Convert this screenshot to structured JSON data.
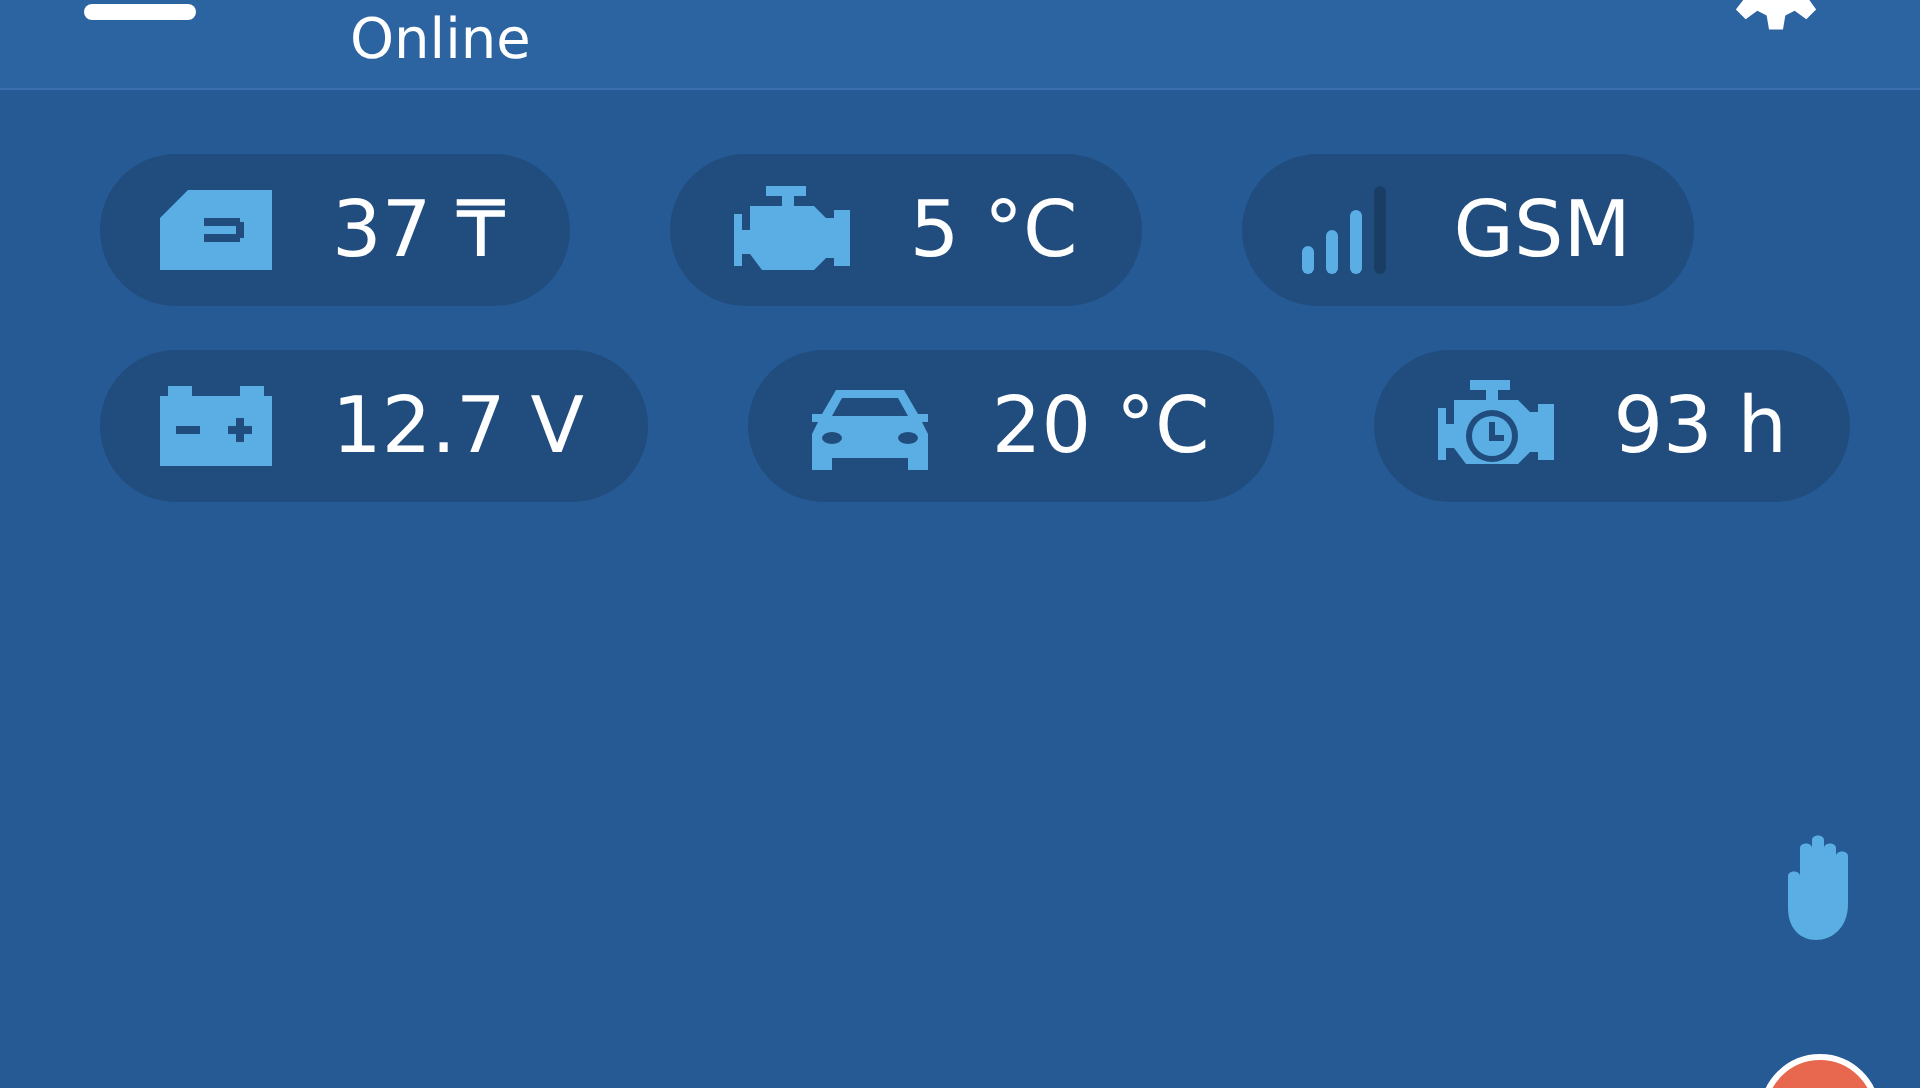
{
  "header": {
    "status": "Online"
  },
  "rows": [
    [
      {
        "kind": "sim",
        "value": "37 ₸"
      },
      {
        "kind": "engine",
        "value": "5 °C"
      },
      {
        "kind": "signal",
        "value": "GSM"
      }
    ],
    [
      {
        "kind": "battery",
        "value": "12.7 V"
      },
      {
        "kind": "car",
        "value": "20 °C"
      },
      {
        "kind": "engine-timer",
        "value": "93 h"
      }
    ]
  ]
}
